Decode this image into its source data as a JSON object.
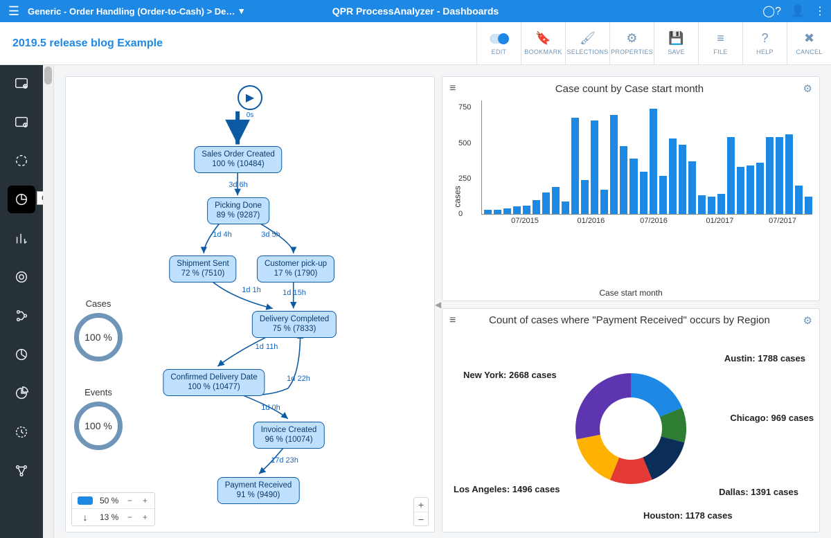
{
  "header": {
    "breadcrumb": "Generic - Order Handling (Order-to-Cash) > De…",
    "app_title": "QPR ProcessAnalyzer - Dashboards"
  },
  "subbar": {
    "dashboard_name": "2019.5 release blog Example",
    "buttons": {
      "edit": "EDIT",
      "bookmark": "BOOKMARK",
      "selections": "SELECTIONS",
      "properties": "PROPERTIES",
      "save": "SAVE",
      "file": "FILE",
      "help": "HELP",
      "cancel": "CANCEL"
    }
  },
  "siderail": {
    "tooltip_chartview": "ChartView"
  },
  "flow": {
    "start_label": "0s",
    "nodes": {
      "n1": {
        "title": "Sales Order Created",
        "stat": "100 % (10484)"
      },
      "n2": {
        "title": "Picking Done",
        "stat": "89 % (9287)"
      },
      "n3": {
        "title": "Shipment Sent",
        "stat": "72 % (7510)"
      },
      "n4": {
        "title": "Customer pick-up",
        "stat": "17 % (1790)"
      },
      "n5": {
        "title": "Delivery Completed",
        "stat": "75 % (7833)"
      },
      "n6": {
        "title": "Confirmed Delivery Date",
        "stat": "100 % (10477)"
      },
      "n7": {
        "title": "Invoice Created",
        "stat": "96 % (10074)"
      },
      "n8": {
        "title": "Payment Received",
        "stat": "91 % (9490)"
      }
    },
    "edge_labels": {
      "e12": "3d 6h",
      "e23": "1d 4h",
      "e24": "3d 5h",
      "e35": "1d 1h",
      "e45": "1d 15h",
      "e56": "1d 11h",
      "e65": "1d 22h",
      "e67": "1d 0h",
      "e78": "17d 23h"
    },
    "metrics": {
      "cases_label": "Cases",
      "cases_value": "100 %",
      "events_label": "Events",
      "events_value": "100 %"
    },
    "legend": {
      "row1_value": "50 %",
      "row2_value": "13 %"
    }
  },
  "barpanel": {
    "title": "Case count by Case start month",
    "ylabel": "cases",
    "xlabel": "Case start month"
  },
  "donutpanel": {
    "title": "Count of cases where \"Payment Received\" occurs by Region"
  },
  "chart_data": [
    {
      "type": "bar",
      "title": "Case count by Case start month",
      "ylabel": "cases",
      "xlabel": "Case start month",
      "ylim": [
        0,
        800
      ],
      "yticks": [
        0,
        250,
        500,
        750
      ],
      "xticks_shown": [
        "07/2015",
        "01/2016",
        "07/2016",
        "01/2017",
        "07/2017"
      ],
      "values": [
        30,
        30,
        40,
        55,
        60,
        100,
        150,
        190,
        90,
        680,
        240,
        660,
        170,
        700,
        480,
        390,
        300,
        740,
        270,
        530,
        490,
        370,
        130,
        120,
        140,
        540,
        330,
        340,
        360,
        540,
        540,
        560,
        200,
        120
      ]
    },
    {
      "type": "pie",
      "title": "Count of cases where \"Payment Received\" occurs by Region",
      "series": [
        {
          "name": "Austin",
          "value": 1788,
          "color": "#1e88e5",
          "label": "Austin: 1788 cases"
        },
        {
          "name": "Chicago",
          "value": 969,
          "color": "#2e7d32",
          "label": "Chicago: 969 cases"
        },
        {
          "name": "Dallas",
          "value": 1391,
          "color": "#0b2e59",
          "label": "Dallas: 1391 cases"
        },
        {
          "name": "Houston",
          "value": 1178,
          "color": "#e53935",
          "label": "Houston: 1178 cases"
        },
        {
          "name": "Los Angeles",
          "value": 1496,
          "color": "#ffb300",
          "label": "Los Angeles: 1496 cases"
        },
        {
          "name": "New York",
          "value": 2668,
          "color": "#5e35b1",
          "label": "New York: 2668 cases"
        }
      ]
    }
  ]
}
